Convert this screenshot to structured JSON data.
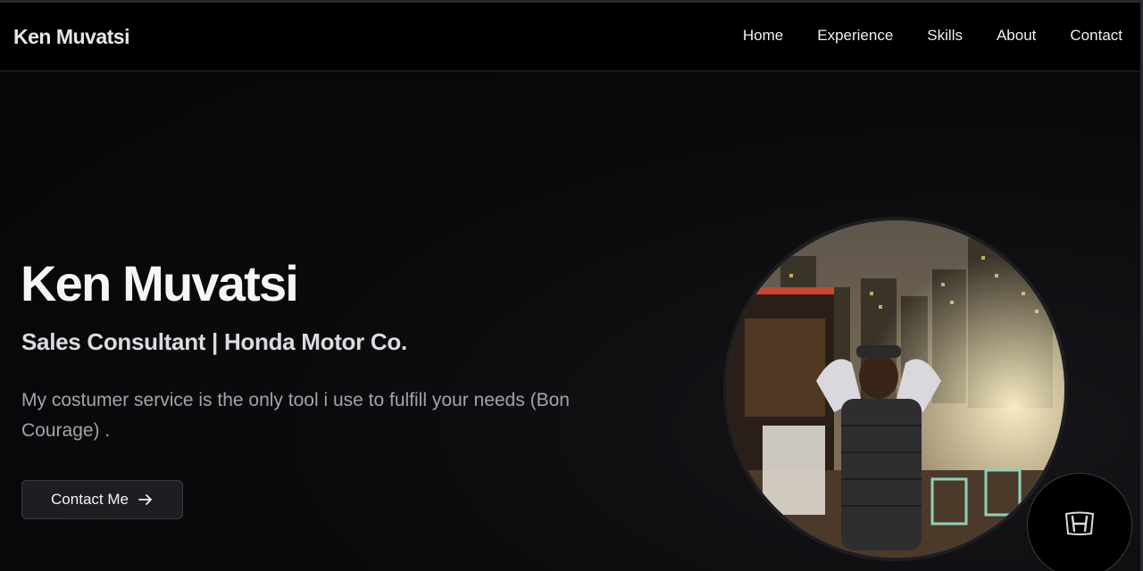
{
  "navbar": {
    "brand": "Ken Muvatsi",
    "links": [
      {
        "label": "Home"
      },
      {
        "label": "Experience"
      },
      {
        "label": "Skills"
      },
      {
        "label": "About"
      },
      {
        "label": "Contact"
      }
    ]
  },
  "hero": {
    "name": "Ken Muvatsi",
    "role": "Sales Consultant | Honda Motor Co.",
    "description": "My costumer service is the only tool i use to fulfill your needs (Bon Courage) .",
    "cta_label": "Contact Me",
    "cta_icon": "arrow-right-icon"
  },
  "portrait": {
    "icon": "profile-photo"
  },
  "badge": {
    "icon": "honda-logo-icon"
  },
  "colors": {
    "background": "#000000",
    "text_primary": "#f5f5f7",
    "text_secondary": "#a3a3ab",
    "button_bg": "#1e1e22",
    "border": "#2b2b30"
  }
}
